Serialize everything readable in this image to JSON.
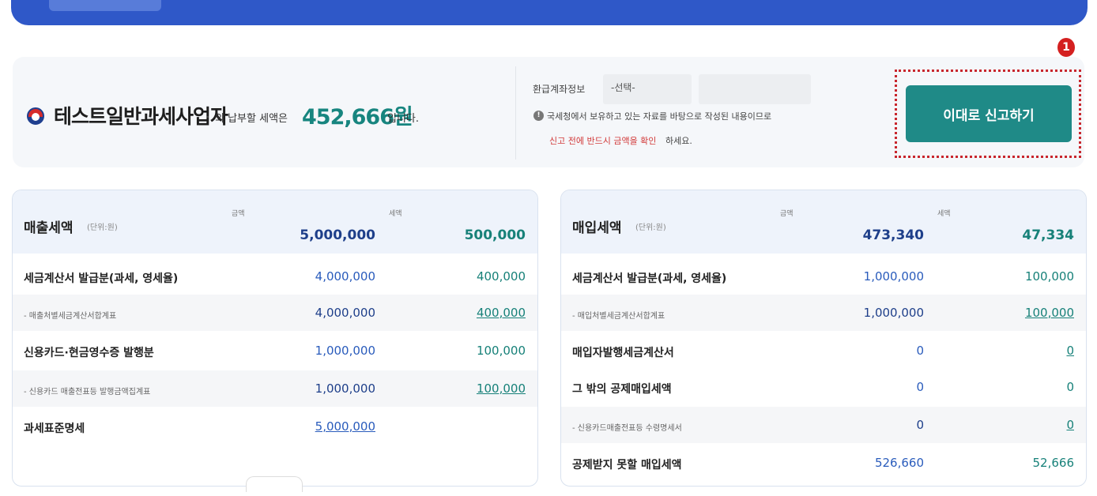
{
  "summary": {
    "company": "테스트일반과세사업자",
    "pay_prefix": "의 납부할 세액은",
    "pay_amount": "452,666원",
    "pay_suffix": "입니다.",
    "refund_label": "환급계좌정보",
    "refund_select": "-선택-",
    "info_text": "국세청에서 보유하고 있는 자료를 바탕으로 작성된 내용이므로",
    "warn_red": "신고 전에 반드시 금액을 확인",
    "warn_rest": "하세요.",
    "callout_number": "1",
    "submit_label": "이대로 신고하기"
  },
  "sales": {
    "title": "매출세액",
    "unit": "(단위:원)",
    "col_amount": "금액",
    "col_tax": "세액",
    "total_amount": "5,000,000",
    "total_tax": "500,000",
    "rows": [
      {
        "label": "세금계산서 발급분(과세, 영세율)",
        "amount": "4,000,000",
        "tax": "400,000"
      },
      {
        "label": "- 매출처별세금계산서합계표",
        "amount": "4,000,000",
        "tax": "400,000"
      },
      {
        "label": "신용카드·현금영수증 발행분",
        "amount": "1,000,000",
        "tax": "100,000"
      },
      {
        "label": "- 신용카드 매출전표등 발행금액집계표",
        "amount": "1,000,000",
        "tax": "100,000"
      },
      {
        "label": "과세표준명세",
        "amount": "5,000,000",
        "tax": ""
      }
    ]
  },
  "purchase": {
    "title": "매입세액",
    "unit": "(단위:원)",
    "col_amount": "금액",
    "col_tax": "세액",
    "total_amount": "473,340",
    "total_tax": "47,334",
    "rows": [
      {
        "label": "세금계산서 발급분(과세, 영세율)",
        "amount": "1,000,000",
        "tax": "100,000"
      },
      {
        "label": "- 매입처별세금계산서합계표",
        "amount": "1,000,000",
        "tax": "100,000"
      },
      {
        "label": "매입자발행세금계산서",
        "amount": "0",
        "tax": "0"
      },
      {
        "label": "그 밖의 공제매입세액",
        "amount": "0",
        "tax": "0"
      },
      {
        "label": "- 신용카드매출전표등 수령명세서",
        "amount": "0",
        "tax": "0"
      },
      {
        "label": "공제받지 못할 매입세액",
        "amount": "526,660",
        "tax": "52,666"
      }
    ]
  }
}
